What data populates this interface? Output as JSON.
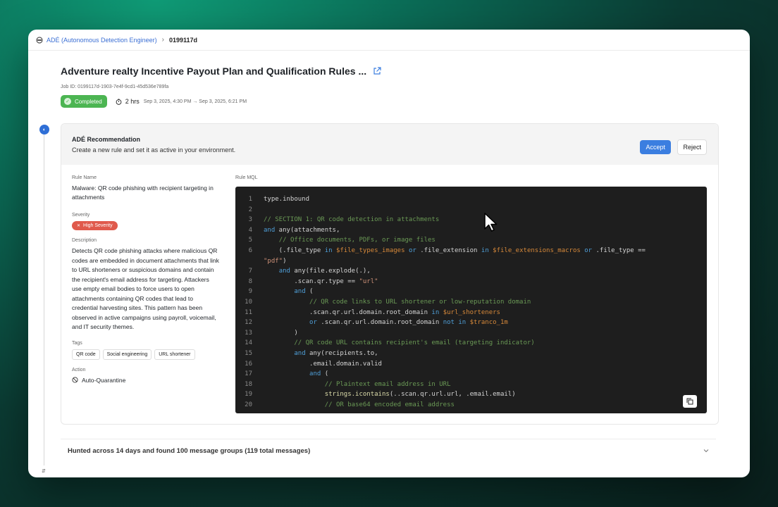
{
  "breadcrumb": {
    "app_label": "ADÉ (Autonomous Detection Engineer)",
    "current": "0199117d"
  },
  "job": {
    "title": "Adventure realty Incentive Payout Plan and Qualification Rules ...",
    "job_id": "Job ID: 0199117d-1903-7e4f-9cd1-45d536e789fa",
    "status": "Completed",
    "duration": "2 hrs",
    "range": "Sep 3, 2025, 4:30 PM → Sep 3, 2025, 6:21 PM"
  },
  "recommendation": {
    "title": "ADÉ Recommendation",
    "subtitle": "Create a new rule and set it as active in your environment.",
    "accept_label": "Accept",
    "reject_label": "Reject"
  },
  "rule": {
    "name_label": "Rule Name",
    "name": "Malware: QR code phishing with recipient targeting in attachments",
    "severity_label": "Severity",
    "severity": "High Severity",
    "description_label": "Description",
    "description": "Detects QR code phishing attacks where malicious QR codes are embedded in document attachments that link to URL shorteners or suspicious domains and contain the recipient's email address for targeting. Attackers use empty email bodies to force users to open attachments containing QR codes that lead to credential harvesting sites. This pattern has been observed in active campaigns using payroll, voicemail, and IT security themes.",
    "tags_label": "Tags",
    "tags": [
      "QR code",
      "Social engineering",
      "URL shortener"
    ],
    "action_label": "Action",
    "action": "Auto-Quarantine",
    "mql_label": "Rule MQL"
  },
  "code_lines": [
    {
      "n": "1",
      "html": "type.inbound"
    },
    {
      "n": "2",
      "html": ""
    },
    {
      "n": "3",
      "html": "<span class='c-cm'>// SECTION 1: QR code detection in attachments</span>"
    },
    {
      "n": "4",
      "html": "<span class='c-kw'>and</span> any(attachments,"
    },
    {
      "n": "5",
      "html": "    <span class='c-cm'>// Office documents, PDFs, or image files</span>"
    },
    {
      "n": "6",
      "html": "    (.file_type <span class='c-kw'>in</span> <span class='c-var'>$file_types_images</span> <span class='c-kw'>or</span> .file_extension <span class='c-kw'>in</span> <span class='c-var'>$file_extensions_macros</span> <span class='c-kw'>or</span> .file_type =="
    },
    {
      "n": "",
      "html": "<span class='c-str'>\"pdf\"</span>)"
    },
    {
      "n": "7",
      "html": "    <span class='c-kw'>and</span> any(file.explode(.),"
    },
    {
      "n": "8",
      "html": "        .scan.qr.type == <span class='c-str'>\"url\"</span>"
    },
    {
      "n": "9",
      "html": "        <span class='c-kw'>and</span> ("
    },
    {
      "n": "10",
      "html": "            <span class='c-cm'>// QR code links to URL shortener or low-reputation domain</span>"
    },
    {
      "n": "11",
      "html": "            .scan.qr.url.domain.root_domain <span class='c-kw'>in</span> <span class='c-var'>$url_shorteners</span>"
    },
    {
      "n": "12",
      "html": "            <span class='c-kw'>or</span> .scan.qr.url.domain.root_domain <span class='c-kw'>not in</span> <span class='c-var'>$tranco_1m</span>"
    },
    {
      "n": "13",
      "html": "        )"
    },
    {
      "n": "14",
      "html": "        <span class='c-cm'>// QR code URL contains recipient's email (targeting indicator)</span>"
    },
    {
      "n": "15",
      "html": "        <span class='c-kw'>and</span> any(recipients.to,"
    },
    {
      "n": "16",
      "html": "            .email.domain.valid"
    },
    {
      "n": "17",
      "html": "            <span class='c-kw'>and</span> ("
    },
    {
      "n": "18",
      "html": "                <span class='c-cm'>// Plaintext email address in URL</span>"
    },
    {
      "n": "19",
      "html": "                <span class='c-fn'>strings.icontains</span>(..scan.qr.url.url, .email.email)"
    },
    {
      "n": "20",
      "html": "                <span class='c-cm'>// OR base64 encoded email address</span>"
    }
  ],
  "hunt": {
    "summary": "Hunted across 14 days and found 100 message groups (119 total messages)"
  },
  "colors": {
    "accent": "#3b7ee0",
    "success": "#4cb552",
    "danger": "#e05a4c",
    "code_bg": "#1e1e1e"
  }
}
